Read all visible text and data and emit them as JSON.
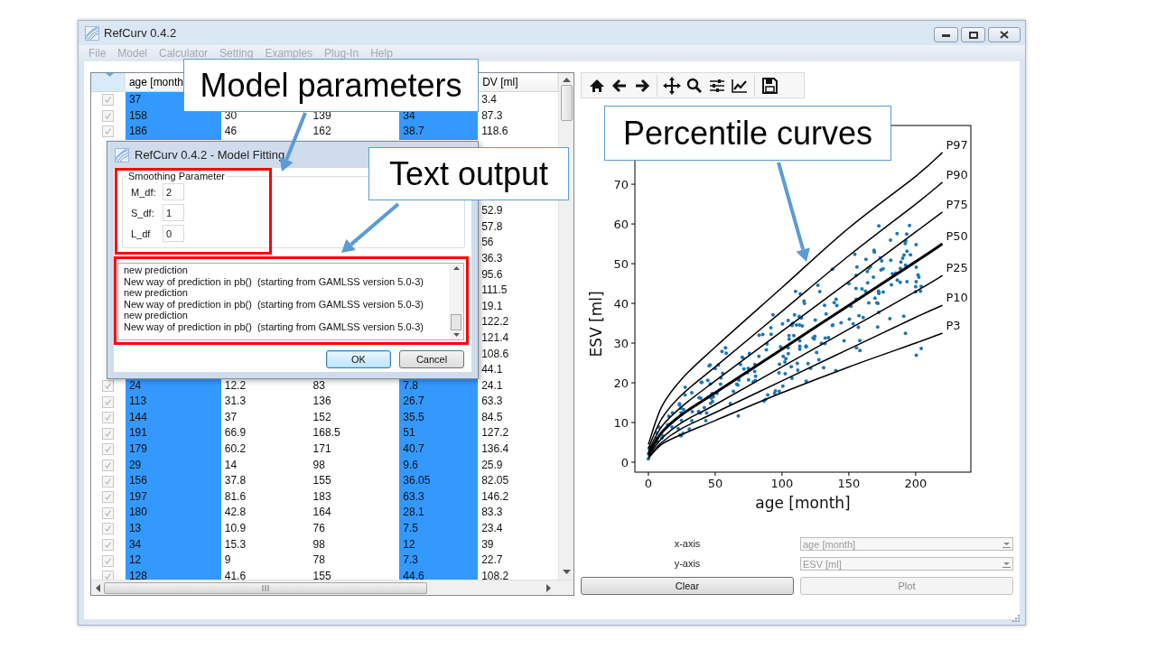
{
  "window": {
    "title": "RefCurv 0.4.2"
  },
  "menu": [
    {
      "label": "File",
      "disabled": true
    },
    {
      "label": "Model",
      "disabled": true
    },
    {
      "label": "Calculator",
      "disabled": true
    },
    {
      "label": "Setting",
      "disabled": true
    },
    {
      "label": "Examples",
      "disabled": true
    },
    {
      "label": "Plug-In",
      "disabled": true
    },
    {
      "label": "Help",
      "disabled": true
    }
  ],
  "table": {
    "columns": [
      {
        "label": "age [month",
        "selected": true
      },
      {
        "selected": false
      },
      {
        "selected": false
      },
      {
        "selected": true
      },
      {
        "label": "DV [ml]",
        "selected": false
      }
    ],
    "rows_top": [
      {
        "checked": true,
        "column_1": "37",
        "column_5": "3.4"
      },
      {
        "checked": true,
        "column_1": "158",
        "column_2": "30",
        "column_3": "139",
        "column_4": "34",
        "column_5": "87.3"
      },
      {
        "checked": true,
        "column_1": "186",
        "column_2": "46",
        "column_3": "162",
        "column_4": "38.7",
        "column_5": "118.6"
      }
    ],
    "rows_beside_dialog": [
      {
        "column_5": "52.9"
      },
      {
        "column_5": "57.8"
      },
      {
        "column_5": "56"
      },
      {
        "column_5": "36.3"
      },
      {
        "column_5": "95.6"
      },
      {
        "column_5": "111.5"
      },
      {
        "column_5": "19.1"
      },
      {
        "column_5": "122.2"
      },
      {
        "column_5": "121.4"
      },
      {
        "column_5": "108.6"
      },
      {
        "column_5": "44.1"
      }
    ],
    "rows_bottom": [
      {
        "checked": true,
        "column_1": "24",
        "column_2": "12.2",
        "column_3": "83",
        "column_4": "7.8",
        "column_5": "24.1"
      },
      {
        "checked": true,
        "column_1": "113",
        "column_2": "31.3",
        "column_3": "136",
        "column_4": "26.7",
        "column_5": "63.3"
      },
      {
        "checked": true,
        "column_1": "144",
        "column_2": "37",
        "column_3": "152",
        "column_4": "35.5",
        "column_5": "84.5"
      },
      {
        "checked": true,
        "column_1": "191",
        "column_2": "66.9",
        "column_3": "168.5",
        "column_4": "51",
        "column_5": "127.2"
      },
      {
        "checked": true,
        "column_1": "179",
        "column_2": "60.2",
        "column_3": "171",
        "column_4": "40.7",
        "column_5": "136.4"
      },
      {
        "checked": true,
        "column_1": "29",
        "column_2": "14",
        "column_3": "98",
        "column_4": "9.6",
        "column_5": "25.9"
      },
      {
        "checked": true,
        "column_1": "156",
        "column_2": "37.8",
        "column_3": "155",
        "column_4": "36.05",
        "column_5": "82.05"
      },
      {
        "checked": true,
        "column_1": "197",
        "column_2": "81.6",
        "column_3": "183",
        "column_4": "63.3",
        "column_5": "146.2"
      },
      {
        "checked": true,
        "column_1": "180",
        "column_2": "42.8",
        "column_3": "164",
        "column_4": "28.1",
        "column_5": "83.3"
      },
      {
        "checked": true,
        "column_1": "13",
        "column_2": "10.9",
        "column_3": "76",
        "column_4": "7.5",
        "column_5": "23.4"
      },
      {
        "checked": true,
        "column_1": "34",
        "column_2": "15.3",
        "column_3": "98",
        "column_4": "12",
        "column_5": "39"
      },
      {
        "checked": true,
        "column_1": "12",
        "column_2": "9",
        "column_3": "78",
        "column_4": "7.3",
        "column_5": "22.7"
      },
      {
        "checked": true,
        "column_1": "128",
        "column_2": "41.6",
        "column_3": "155",
        "column_4": "44.6",
        "column_5": "108.2"
      }
    ]
  },
  "plot": {
    "chart_data": {
      "type": "line",
      "xlabel": "age [month]",
      "ylabel": "ESV [ml]",
      "x": [
        0,
        10,
        25,
        50,
        100,
        150,
        200,
        220
      ],
      "series": [
        {
          "name": "P97",
          "color": "#000000",
          "values": [
            4.5,
            14,
            21,
            29,
            44,
            59,
            72,
            78
          ]
        },
        {
          "name": "P90",
          "color": "#000000",
          "values": [
            3.5,
            11,
            17,
            24,
            38,
            52,
            65,
            70.5
          ]
        },
        {
          "name": "P75",
          "color": "#000000",
          "values": [
            2.8,
            9,
            14,
            20.5,
            33,
            45.5,
            58,
            63
          ]
        },
        {
          "name": "P50",
          "color": "#000000",
          "values": [
            2,
            7.5,
            12,
            17.5,
            28.5,
            39.5,
            50.5,
            55
          ]
        },
        {
          "name": "P25",
          "color": "#000000",
          "values": [
            1.5,
            6,
            10,
            14.5,
            24,
            33.5,
            43,
            47
          ]
        },
        {
          "name": "P10",
          "color": "#000000",
          "values": [
            1.2,
            5,
            8.5,
            12.5,
            20.5,
            28.5,
            36.5,
            39.5
          ]
        },
        {
          "name": "P3",
          "color": "#000000",
          "values": [
            1,
            4.5,
            7,
            10.5,
            17.5,
            24,
            30,
            32.5
          ]
        }
      ],
      "xlim": [
        -10.1,
        241.3
      ],
      "ylim": [
        -2.5,
        84.8
      ],
      "xticks": [
        0,
        50,
        100,
        150,
        200
      ],
      "yticks": [
        0,
        10,
        20,
        30,
        40,
        50,
        60,
        70
      ]
    },
    "x_axis": {
      "label": "x-axis",
      "value": "age [month]",
      "disabled": true
    },
    "y_axis": {
      "label": "y-axis",
      "value": "ESV [ml]",
      "disabled": true
    },
    "buttons": [
      {
        "label": "Clear",
        "disabled": false
      },
      {
        "label": "Plot",
        "disabled": true
      }
    ]
  },
  "dialog": {
    "title": "RefCurv 0.4.2 - Model Fitting",
    "group": "Smoothing Parameter",
    "fields": [
      {
        "label": "M_df:",
        "value": "2"
      },
      {
        "label": "S_df:",
        "value": "1"
      },
      {
        "label": "L_df",
        "value": "0"
      }
    ],
    "output": [
      "new prediction",
      "New way of prediction in pb()  (starting from GAMLSS version 5.0-3)",
      "new prediction",
      "New way of prediction in pb()  (starting from GAMLSS version 5.0-3)",
      "new prediction",
      "New way of prediction in pb()  (starting from GAMLSS version 5.0-3)"
    ],
    "buttons": [
      {
        "label": "OK",
        "focused": true
      },
      {
        "label": "Cancel",
        "focused": false
      }
    ]
  },
  "callouts": [
    {
      "text": "Model parameters"
    },
    {
      "text": "Text output"
    },
    {
      "text": "Percentile curves"
    }
  ]
}
